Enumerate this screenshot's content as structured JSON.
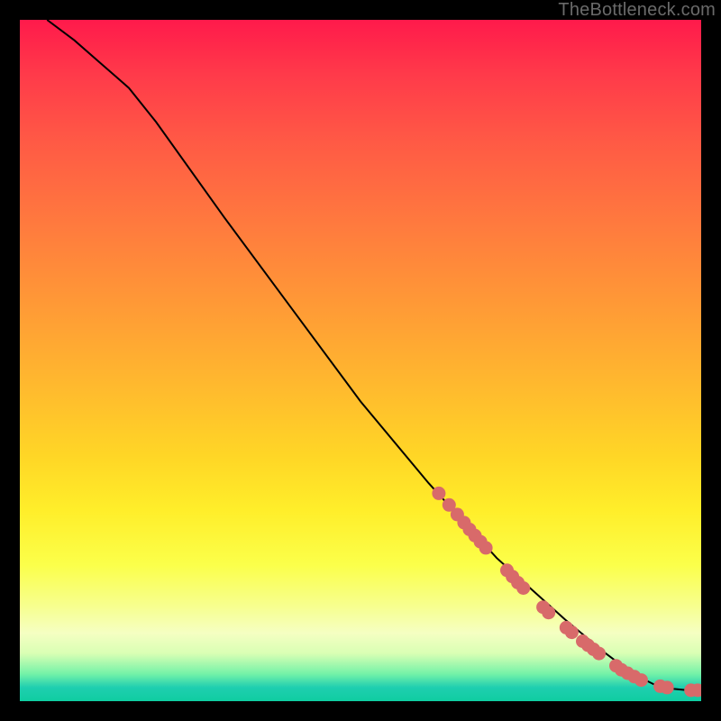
{
  "watermark": "TheBottleneck.com",
  "colors": {
    "marker": "#d86a6a",
    "marker_stroke": "#a64a4a",
    "line": "#000000",
    "frame": "#000000"
  },
  "chart_data": {
    "type": "line",
    "title": "",
    "xlabel": "",
    "ylabel": "",
    "xlim": [
      0,
      100
    ],
    "ylim": [
      0,
      100
    ],
    "grid": false,
    "legend": false,
    "curve_comment": "Descending curve from top-left to bottom-right; y is percentage of plot height from bottom, x is percentage of plot width from left. No axis ticks are rendered so values are normalized 0–100 estimates read from pixel positions.",
    "curve": [
      {
        "x": 4.0,
        "y": 100.0
      },
      {
        "x": 8.0,
        "y": 97.0
      },
      {
        "x": 12.0,
        "y": 93.5
      },
      {
        "x": 16.0,
        "y": 90.0
      },
      {
        "x": 20.0,
        "y": 85.0
      },
      {
        "x": 30.0,
        "y": 71.0
      },
      {
        "x": 40.0,
        "y": 57.5
      },
      {
        "x": 50.0,
        "y": 44.0
      },
      {
        "x": 60.0,
        "y": 32.0
      },
      {
        "x": 70.0,
        "y": 21.0
      },
      {
        "x": 80.0,
        "y": 12.0
      },
      {
        "x": 86.0,
        "y": 7.0
      },
      {
        "x": 90.0,
        "y": 4.0
      },
      {
        "x": 93.0,
        "y": 2.5
      },
      {
        "x": 96.0,
        "y": 1.8
      },
      {
        "x": 98.0,
        "y": 1.6
      },
      {
        "x": 100.0,
        "y": 1.6
      }
    ],
    "markers_comment": "Pink/coral circular markers clustered along the lower-right portion of the curve. Same coordinate convention as curve.",
    "markers": [
      {
        "x": 61.5,
        "y": 30.5
      },
      {
        "x": 63.0,
        "y": 28.8
      },
      {
        "x": 64.2,
        "y": 27.4
      },
      {
        "x": 65.2,
        "y": 26.2
      },
      {
        "x": 66.0,
        "y": 25.2
      },
      {
        "x": 66.8,
        "y": 24.3
      },
      {
        "x": 67.6,
        "y": 23.4
      },
      {
        "x": 68.4,
        "y": 22.5
      },
      {
        "x": 71.5,
        "y": 19.2
      },
      {
        "x": 72.3,
        "y": 18.3
      },
      {
        "x": 73.1,
        "y": 17.4
      },
      {
        "x": 73.9,
        "y": 16.6
      },
      {
        "x": 76.8,
        "y": 13.8
      },
      {
        "x": 77.6,
        "y": 13.0
      },
      {
        "x": 80.2,
        "y": 10.8
      },
      {
        "x": 81.0,
        "y": 10.1
      },
      {
        "x": 82.6,
        "y": 8.8
      },
      {
        "x": 83.4,
        "y": 8.2
      },
      {
        "x": 84.2,
        "y": 7.6
      },
      {
        "x": 85.0,
        "y": 7.0
      },
      {
        "x": 87.5,
        "y": 5.2
      },
      {
        "x": 88.3,
        "y": 4.6
      },
      {
        "x": 89.2,
        "y": 4.1
      },
      {
        "x": 90.2,
        "y": 3.6
      },
      {
        "x": 91.2,
        "y": 3.1
      },
      {
        "x": 94.0,
        "y": 2.2
      },
      {
        "x": 95.0,
        "y": 2.0
      },
      {
        "x": 98.5,
        "y": 1.6
      },
      {
        "x": 99.5,
        "y": 1.6
      }
    ]
  }
}
